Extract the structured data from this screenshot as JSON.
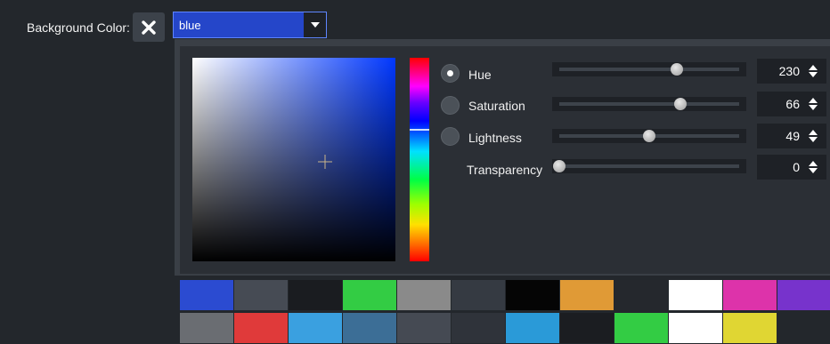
{
  "header": {
    "label": "Background Color:",
    "clear_icon": "close-icon",
    "select_value": "blue",
    "select_arrow_icon": "caret-down-icon"
  },
  "picker": {
    "mode_rows": [
      {
        "label": "Hue",
        "selected": true,
        "value": "230",
        "slider_fraction": 0.64
      },
      {
        "label": "Saturation",
        "selected": false,
        "value": "66",
        "slider_fraction": 0.66
      },
      {
        "label": "Lightness",
        "selected": false,
        "value": "49",
        "slider_fraction": 0.49
      }
    ],
    "transparency": {
      "label": "Transparency",
      "value": "0",
      "slider_fraction": 0.0
    },
    "current_color": "#2546c9"
  },
  "swatches": {
    "row1": [
      "#2b4bd1",
      "#464b54",
      "#1a1c20",
      "#33cc44",
      "#8a8a8a",
      "#353a42",
      "#050505",
      "#e09a36",
      "#25282d",
      "#ffffff",
      "#dd33aa",
      "#7733cc"
    ],
    "row2": [
      "#6a6d72",
      "#e03a3a",
      "#3aa0e0",
      "#3c6e96",
      "#454a53",
      "#2f333a",
      "#2a9ad8",
      "#1b1d21",
      "#33cc44",
      "#ffffff",
      "#e0d633"
    ]
  }
}
